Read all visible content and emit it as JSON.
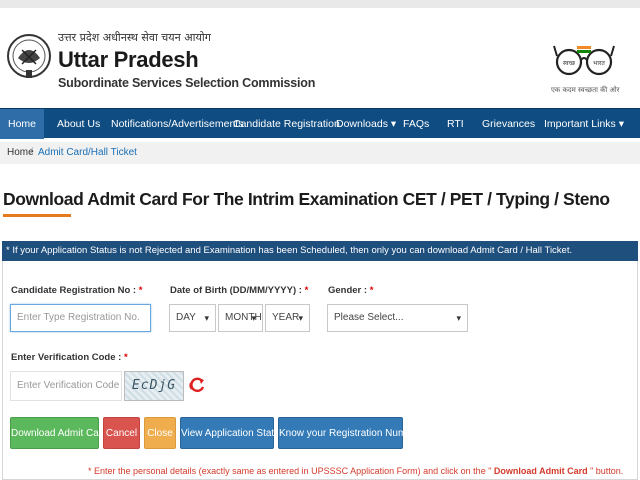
{
  "header": {
    "hindi_name": "उत्तर प्रदेश अधीनस्थ सेवा चयन आयोग",
    "org_name": "Uttar Pradesh",
    "org_subtitle": "Subordinate Services Selection Commission",
    "swachh_left": "स्वच्छ",
    "swachh_right": "भारत",
    "swachh_tagline": "एक कदम स्वच्छता की ओर"
  },
  "nav": {
    "items": [
      {
        "label": "Home"
      },
      {
        "label": "About Us"
      },
      {
        "label": "Notifications/Advertisements"
      },
      {
        "label": "Candidate Registration"
      },
      {
        "label": "Downloads ▾"
      },
      {
        "label": "FAQs"
      },
      {
        "label": "RTI"
      },
      {
        "label": "Grievances"
      },
      {
        "label": "Important Links ▾"
      }
    ]
  },
  "breadcrumb": {
    "home": "Home",
    "separator": "/",
    "current": "Admit Card/Hall Ticket"
  },
  "page": {
    "title": "Download Admit Card For The Intrim Examination CET / PET / Typing / Steno"
  },
  "form": {
    "notice": "* If your Application Status is not Rejected and Examination has been Scheduled, then only you can download Admit Card / Hall Ticket.",
    "reg_label": "Candidate Registration No :",
    "reg_placeholder": "Enter Type Registration No.",
    "dob_label": "Date of Birth (DD/MM/YYYY) :",
    "day": "DAY",
    "month": "MONTH",
    "year": "YEAR",
    "gender_label": "Gender :",
    "gender_value": "Please Select...",
    "captcha_label": "Enter Verification Code :",
    "captcha_placeholder": "Enter Verification Code",
    "captcha_text": "EcDjG",
    "required_mark": "*"
  },
  "buttons": {
    "download": "Download Admit Card",
    "cancel": "Cancel",
    "close": "Close",
    "view_status": "View Application Status",
    "know_reg": "Know your Registration Number"
  },
  "footnote": {
    "text": "* Enter the personal details (exactly same as entered in UPSSSC Application Form) and click on the \"",
    "bold": " Download Admit Card ",
    "tail": "\" button."
  },
  "colors": {
    "nav_bg": "#0f4c81",
    "notice_bg": "#1e4f7d",
    "accent_orange": "#e57b1e",
    "button_green": "#5cb85c",
    "button_red": "#d9534f",
    "button_orange": "#f0ad4e",
    "button_blue": "#337ab7"
  }
}
